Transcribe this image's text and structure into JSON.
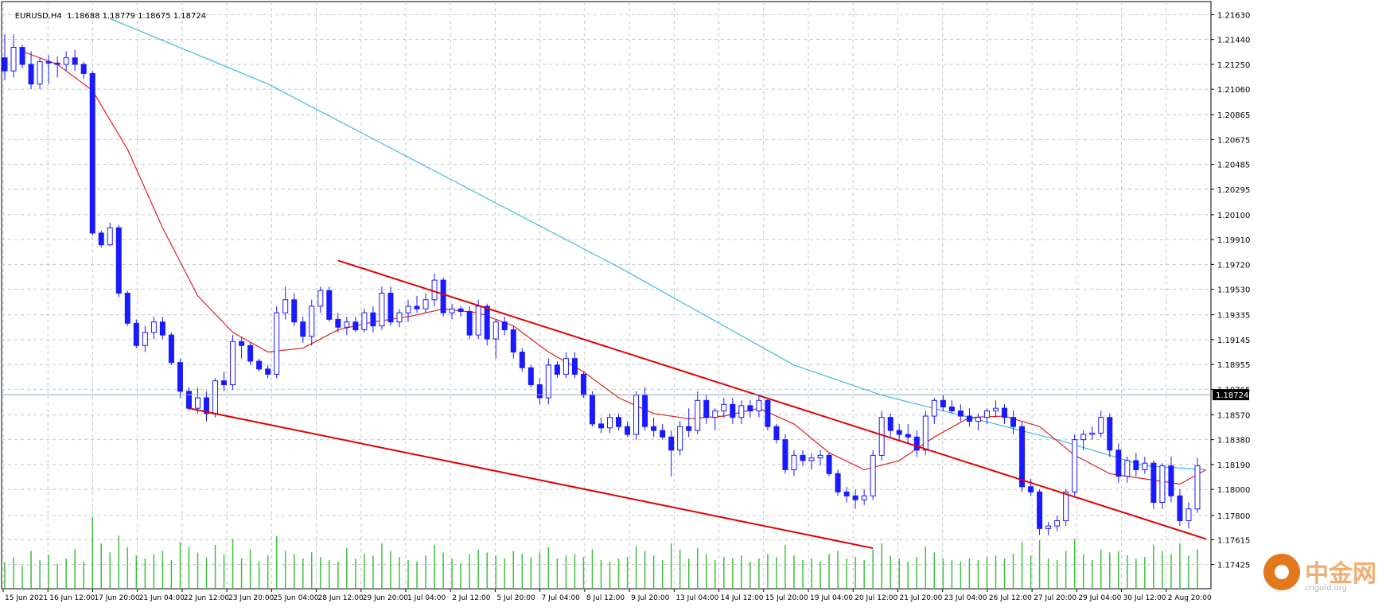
{
  "header": {
    "symbol": "EURUSD,H4",
    "ohlc": "1.18688 1.18779 1.18675 1.18724"
  },
  "colors": {
    "background": "#ffffff",
    "grid": "#c0c8d0",
    "candle": "#1a1aff",
    "ma_fast": "#e02020",
    "ma_slow": "#40b8e8",
    "trendline": "#e00000",
    "volume": "#40c040",
    "price_line": "#8aa6bf",
    "price_label_bg": "#000000",
    "price_label_text": "#ffffff"
  },
  "chart_data": {
    "type": "candlestick",
    "symbol": "EURUSD",
    "timeframe": "H4",
    "current_price": "1.18724",
    "ylim": [
      1.1724,
      1.2173
    ],
    "grid": true,
    "y_ticks": [
      "1.21630",
      "1.21440",
      "1.21250",
      "1.21060",
      "1.20865",
      "1.20675",
      "1.20485",
      "1.20295",
      "1.20100",
      "1.19910",
      "1.19720",
      "1.19530",
      "1.19335",
      "1.19145",
      "1.18955",
      "1.18765",
      "1.18570",
      "1.18380",
      "1.18190",
      "1.18000",
      "1.17800",
      "1.17615",
      "1.17425"
    ],
    "x_ticks": [
      "15 Jun 2021",
      "16 Jun 12:00",
      "17 Jun 20:00",
      "21 Jun 04:00",
      "22 Jun 12:00",
      "23 Jun 20:00",
      "25 Jun 04:00",
      "28 Jun 12:00",
      "29 Jun 20:00",
      "1 Jul 04:00",
      "2 Jul 12:00",
      "5 Jul 20:00",
      "7 Jul 04:00",
      "8 Jul 12:00",
      "9 Jul 20:00",
      "13 Jul 04:00",
      "14 Jul 12:00",
      "15 Jul 20:00",
      "19 Jul 04:00",
      "20 Jul 12:00",
      "21 Jul 20:00",
      "23 Jul 04:00",
      "26 Jul 12:00",
      "27 Jul 20:00",
      "29 Jul 04:00",
      "30 Jul 12:00",
      "2 Aug 20:00"
    ],
    "bar_count": 137,
    "candles": [
      [
        1.213,
        1.2148,
        1.2113,
        1.212
      ],
      [
        1.212,
        1.2148,
        1.2115,
        1.2138
      ],
      [
        1.2138,
        1.214,
        1.2122,
        1.2125
      ],
      [
        1.2125,
        1.2135,
        1.2106,
        1.211
      ],
      [
        1.211,
        1.213,
        1.2106,
        1.2127
      ],
      [
        1.2127,
        1.2132,
        1.211,
        1.2126
      ],
      [
        1.2126,
        1.2131,
        1.2115,
        1.2125
      ],
      [
        1.2125,
        1.2135,
        1.212,
        1.213
      ],
      [
        1.213,
        1.2136,
        1.212,
        1.2125
      ],
      [
        1.2125,
        1.2127,
        1.2114,
        1.2118
      ],
      [
        1.2118,
        1.212,
        1.1994,
        1.1996
      ],
      [
        1.1996,
        1.1998,
        1.1985,
        1.1987
      ],
      [
        1.1987,
        1.2004,
        1.1986,
        1.2
      ],
      [
        1.2,
        1.2002,
        1.1947,
        1.195
      ],
      [
        1.195,
        1.1952,
        1.1925,
        1.1927
      ],
      [
        1.1927,
        1.193,
        1.1908,
        1.191
      ],
      [
        1.191,
        1.1925,
        1.1905,
        1.192
      ],
      [
        1.192,
        1.1932,
        1.1915,
        1.1928
      ],
      [
        1.1928,
        1.1932,
        1.1915,
        1.1918
      ],
      [
        1.1918,
        1.192,
        1.1895,
        1.1897
      ],
      [
        1.1897,
        1.19,
        1.187,
        1.1875
      ],
      [
        1.1875,
        1.1878,
        1.186,
        1.1862
      ],
      [
        1.1862,
        1.1878,
        1.1858,
        1.187
      ],
      [
        1.187,
        1.1875,
        1.1852,
        1.1858
      ],
      [
        1.1858,
        1.1885,
        1.1855,
        1.1883
      ],
      [
        1.1883,
        1.189,
        1.1875,
        1.188
      ],
      [
        1.188,
        1.1918,
        1.1876,
        1.1913
      ],
      [
        1.1913,
        1.1916,
        1.19,
        1.191
      ],
      [
        1.191,
        1.1912,
        1.1895,
        1.1898
      ],
      [
        1.1898,
        1.19,
        1.189,
        1.1892
      ],
      [
        1.1892,
        1.1895,
        1.1885,
        1.1888
      ],
      [
        1.1888,
        1.194,
        1.1885,
        1.1935
      ],
      [
        1.1935,
        1.1955,
        1.193,
        1.1945
      ],
      [
        1.1945,
        1.195,
        1.1925,
        1.1928
      ],
      [
        1.1928,
        1.1932,
        1.1912,
        1.1917
      ],
      [
        1.1917,
        1.1945,
        1.191,
        1.194
      ],
      [
        1.194,
        1.1955,
        1.1935,
        1.1952
      ],
      [
        1.1952,
        1.1955,
        1.1928,
        1.193
      ],
      [
        1.193,
        1.1935,
        1.192,
        1.1924
      ],
      [
        1.1924,
        1.1932,
        1.1918,
        1.1928
      ],
      [
        1.1928,
        1.1932,
        1.192,
        1.1922
      ],
      [
        1.1922,
        1.1938,
        1.192,
        1.1935
      ],
      [
        1.1935,
        1.194,
        1.192,
        1.1925
      ],
      [
        1.1925,
        1.1955,
        1.1922,
        1.195
      ],
      [
        1.195,
        1.1955,
        1.1925,
        1.1928
      ],
      [
        1.1928,
        1.1938,
        1.1924,
        1.1935
      ],
      [
        1.1935,
        1.1945,
        1.1928,
        1.194
      ],
      [
        1.194,
        1.1948,
        1.1935,
        1.1938
      ],
      [
        1.1938,
        1.195,
        1.1935,
        1.1945
      ],
      [
        1.1945,
        1.1965,
        1.194,
        1.196
      ],
      [
        1.196,
        1.1962,
        1.1932,
        1.1935
      ],
      [
        1.1935,
        1.1942,
        1.193,
        1.1938
      ],
      [
        1.1938,
        1.194,
        1.1932,
        1.1936
      ],
      [
        1.1936,
        1.194,
        1.1915,
        1.1918
      ],
      [
        1.1918,
        1.1945,
        1.1915,
        1.194
      ],
      [
        1.194,
        1.1942,
        1.191,
        1.1915
      ],
      [
        1.1915,
        1.193,
        1.19,
        1.1928
      ],
      [
        1.1928,
        1.1932,
        1.1918,
        1.1922
      ],
      [
        1.1922,
        1.1925,
        1.19,
        1.1905
      ],
      [
        1.1905,
        1.1908,
        1.189,
        1.1893
      ],
      [
        1.1893,
        1.1895,
        1.1878,
        1.188
      ],
      [
        1.188,
        1.1885,
        1.1865,
        1.187
      ],
      [
        1.187,
        1.19,
        1.1865,
        1.1895
      ],
      [
        1.1895,
        1.1898,
        1.1885,
        1.1888
      ],
      [
        1.1888,
        1.1905,
        1.1885,
        1.19
      ],
      [
        1.19,
        1.1905,
        1.1885,
        1.1888
      ],
      [
        1.1888,
        1.189,
        1.187,
        1.1872
      ],
      [
        1.1872,
        1.1875,
        1.1848,
        1.185
      ],
      [
        1.185,
        1.1855,
        1.1843,
        1.1847
      ],
      [
        1.1847,
        1.1858,
        1.1843,
        1.1855
      ],
      [
        1.1855,
        1.1858,
        1.1845,
        1.1848
      ],
      [
        1.1848,
        1.1852,
        1.184,
        1.1842
      ],
      [
        1.1842,
        1.1875,
        1.1838,
        1.1872
      ],
      [
        1.1872,
        1.1878,
        1.1845,
        1.1848
      ],
      [
        1.1848,
        1.1855,
        1.184,
        1.1845
      ],
      [
        1.1845,
        1.185,
        1.1838,
        1.184
      ],
      [
        1.184,
        1.1845,
        1.181,
        1.183
      ],
      [
        1.183,
        1.1852,
        1.1826,
        1.1848
      ],
      [
        1.1848,
        1.1862,
        1.184,
        1.1845
      ],
      [
        1.1845,
        1.1875,
        1.1842,
        1.1868
      ],
      [
        1.1868,
        1.1872,
        1.185,
        1.1855
      ],
      [
        1.1855,
        1.1862,
        1.1845,
        1.186
      ],
      [
        1.186,
        1.187,
        1.1855,
        1.1865
      ],
      [
        1.1865,
        1.187,
        1.185,
        1.1855
      ],
      [
        1.1855,
        1.1868,
        1.185,
        1.1864
      ],
      [
        1.1864,
        1.1868,
        1.1855,
        1.186
      ],
      [
        1.186,
        1.1872,
        1.1855,
        1.1868
      ],
      [
        1.1868,
        1.187,
        1.1845,
        1.1848
      ],
      [
        1.1848,
        1.185,
        1.1835,
        1.1838
      ],
      [
        1.1838,
        1.1842,
        1.1812,
        1.1815
      ],
      [
        1.1815,
        1.183,
        1.181,
        1.1826
      ],
      [
        1.1826,
        1.183,
        1.1818,
        1.1822
      ],
      [
        1.1822,
        1.1828,
        1.1815,
        1.1824
      ],
      [
        1.1824,
        1.183,
        1.1818,
        1.1826
      ],
      [
        1.1826,
        1.1828,
        1.181,
        1.1812
      ],
      [
        1.1812,
        1.1815,
        1.1795,
        1.1798
      ],
      [
        1.1798,
        1.1802,
        1.179,
        1.1795
      ],
      [
        1.1795,
        1.18,
        1.1785,
        1.1792
      ],
      [
        1.1792,
        1.18,
        1.1788,
        1.1795
      ],
      [
        1.1795,
        1.183,
        1.1792,
        1.1826
      ],
      [
        1.1826,
        1.186,
        1.1822,
        1.1855
      ],
      [
        1.1855,
        1.1858,
        1.184,
        1.1845
      ],
      [
        1.1845,
        1.185,
        1.1838,
        1.1842
      ],
      [
        1.1842,
        1.185,
        1.1835,
        1.184
      ],
      [
        1.184,
        1.1845,
        1.1825,
        1.183
      ],
      [
        1.183,
        1.186,
        1.1826,
        1.1856
      ],
      [
        1.1856,
        1.187,
        1.185,
        1.1868
      ],
      [
        1.1868,
        1.1872,
        1.186,
        1.1863
      ],
      [
        1.1863,
        1.1868,
        1.1858,
        1.186
      ],
      [
        1.186,
        1.1865,
        1.1852,
        1.1856
      ],
      [
        1.1856,
        1.1862,
        1.1848,
        1.1852
      ],
      [
        1.1852,
        1.1858,
        1.1845,
        1.1855
      ],
      [
        1.1855,
        1.1862,
        1.185,
        1.186
      ],
      [
        1.186,
        1.1868,
        1.1855,
        1.1862
      ],
      [
        1.1862,
        1.1865,
        1.185,
        1.1855
      ],
      [
        1.1855,
        1.186,
        1.1842,
        1.1848
      ],
      [
        1.1848,
        1.1852,
        1.1798,
        1.1802
      ],
      [
        1.1802,
        1.1808,
        1.1795,
        1.1798
      ],
      [
        1.1798,
        1.18,
        1.1765,
        1.177
      ],
      [
        1.177,
        1.1775,
        1.1765,
        1.1772
      ],
      [
        1.1772,
        1.178,
        1.1768,
        1.1776
      ],
      [
        1.1776,
        1.18,
        1.1772,
        1.1798
      ],
      [
        1.1798,
        1.1842,
        1.1795,
        1.1838
      ],
      [
        1.1838,
        1.1845,
        1.183,
        1.1842
      ],
      [
        1.1842,
        1.1848,
        1.1838,
        1.1843
      ],
      [
        1.1843,
        1.186,
        1.184,
        1.1855
      ],
      [
        1.1855,
        1.1858,
        1.1825,
        1.183
      ],
      [
        1.183,
        1.1835,
        1.1805,
        1.181
      ],
      [
        1.181,
        1.1825,
        1.1805,
        1.1822
      ],
      [
        1.1822,
        1.1828,
        1.181,
        1.1815
      ],
      [
        1.1815,
        1.1825,
        1.1812,
        1.182
      ],
      [
        1.182,
        1.1822,
        1.1785,
        1.179
      ],
      [
        1.179,
        1.182,
        1.1785,
        1.1818
      ],
      [
        1.1818,
        1.1825,
        1.179,
        1.1795
      ],
      [
        1.1795,
        1.18,
        1.1772,
        1.1776
      ],
      [
        1.1776,
        1.179,
        1.177,
        1.1785
      ],
      [
        1.1785,
        1.1824,
        1.1782,
        1.1818
      ]
    ],
    "volume_scale": [
      0.35,
      0.42,
      0.3,
      0.5,
      0.38,
      0.45,
      0.33,
      0.4,
      0.52,
      0.36,
      0.95,
      0.6,
      0.48,
      0.7,
      0.55,
      0.44,
      0.4,
      0.46,
      0.5,
      0.38,
      0.62,
      0.55,
      0.48,
      0.42,
      0.58,
      0.45,
      0.66,
      0.4,
      0.52,
      0.36,
      0.44,
      0.7,
      0.5,
      0.46,
      0.4,
      0.48,
      0.42,
      0.38,
      0.36,
      0.54,
      0.4,
      0.46,
      0.44,
      0.6,
      0.5,
      0.42,
      0.38,
      0.36,
      0.44,
      0.58,
      0.48,
      0.4,
      0.34,
      0.46,
      0.52,
      0.48,
      0.44,
      0.4,
      0.5,
      0.46,
      0.42,
      0.48,
      0.55,
      0.4,
      0.44,
      0.46,
      0.42,
      0.52,
      0.38,
      0.36,
      0.4,
      0.42,
      0.56,
      0.5,
      0.44,
      0.38,
      0.6,
      0.52,
      0.4,
      0.54,
      0.46,
      0.38,
      0.42,
      0.4,
      0.44,
      0.36,
      0.4,
      0.46,
      0.42,
      0.58,
      0.44,
      0.38,
      0.4,
      0.36,
      0.46,
      0.5,
      0.4,
      0.42,
      0.38,
      0.52,
      0.6,
      0.44,
      0.4,
      0.36,
      0.42,
      0.56,
      0.48,
      0.4,
      0.38,
      0.36,
      0.4,
      0.38,
      0.42,
      0.44,
      0.4,
      0.46,
      0.62,
      0.44,
      0.64,
      0.4,
      0.38,
      0.5,
      0.66,
      0.46,
      0.38,
      0.52,
      0.48,
      0.5,
      0.44,
      0.4,
      0.42,
      0.58,
      0.5,
      0.46,
      0.6,
      0.44,
      0.52
    ],
    "ma_fast": [
      [
        2,
        1.2135
      ],
      [
        6,
        1.2125
      ],
      [
        10,
        1.2105
      ],
      [
        14,
        1.206
      ],
      [
        18,
        1.2
      ],
      [
        22,
        1.1948
      ],
      [
        26,
        1.192
      ],
      [
        30,
        1.1905
      ],
      [
        34,
        1.1908
      ],
      [
        38,
        1.1922
      ],
      [
        42,
        1.1928
      ],
      [
        46,
        1.1932
      ],
      [
        50,
        1.1938
      ],
      [
        54,
        1.1935
      ],
      [
        58,
        1.1925
      ],
      [
        62,
        1.1905
      ],
      [
        66,
        1.189
      ],
      [
        70,
        1.187
      ],
      [
        74,
        1.1858
      ],
      [
        78,
        1.1854
      ],
      [
        82,
        1.1856
      ],
      [
        86,
        1.1862
      ],
      [
        90,
        1.185
      ],
      [
        94,
        1.1828
      ],
      [
        98,
        1.1815
      ],
      [
        102,
        1.1822
      ],
      [
        106,
        1.184
      ],
      [
        110,
        1.1855
      ],
      [
        114,
        1.1856
      ],
      [
        118,
        1.1848
      ],
      [
        122,
        1.1826
      ],
      [
        126,
        1.1812
      ],
      [
        130,
        1.1808
      ],
      [
        134,
        1.1804
      ],
      [
        137,
        1.1815
      ]
    ],
    "ma_slow": [
      [
        12,
        1.216
      ],
      [
        30,
        1.211
      ],
      [
        50,
        1.204
      ],
      [
        70,
        1.197
      ],
      [
        90,
        1.1895
      ],
      [
        100,
        1.1872
      ],
      [
        110,
        1.1855
      ],
      [
        120,
        1.1838
      ],
      [
        130,
        1.1818
      ],
      [
        137,
        1.1815
      ]
    ],
    "trendlines": [
      {
        "from": [
          21,
          1.1862
        ],
        "to": [
          99,
          1.1755
        ]
      },
      {
        "from": [
          38,
          1.1975
        ],
        "to": [
          137,
          1.1762
        ]
      }
    ]
  }
}
